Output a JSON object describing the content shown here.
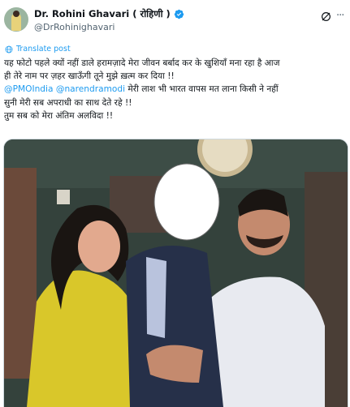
{
  "author": {
    "display_name": "Dr. Rohini Ghavari ( रोहिणी )",
    "handle": "@DrRohinighavari",
    "avatar_icon": "profile-photo",
    "verified_icon": "verified-badge-icon",
    "verified_color": "#1d9bf0"
  },
  "actions": {
    "grok_icon": "grok-icon",
    "more_icon": "more-options-icon",
    "more_glyph": "···"
  },
  "translate": {
    "label": "Translate post",
    "icon": "globe-icon"
  },
  "post": {
    "line1": "यह फोटो पहले क्यों नहीं डाले हरामज़ादे मेरा जीवन बर्बाद कर के खुशियाँ मना रहा है आज",
    "line2": "ही तेरे नाम पर ज़हर खाऊँगी तूने मुझे ख़त्म कर दिया !!",
    "mention1": "@PMOIndia",
    "mention2": "@narendramodi",
    "line3_rest": " मेरी लाश भी भारत वापस मत लाना किसी ने नहीं",
    "line4": "सुनी मेरी सब अपराधी का साथ देते रहे !!",
    "line5": " तुम सब को मेरा अंतिम अलविदा !!"
  },
  "colors": {
    "link": "#1d9bf0",
    "text": "#0f1419",
    "secondary": "#536471"
  }
}
